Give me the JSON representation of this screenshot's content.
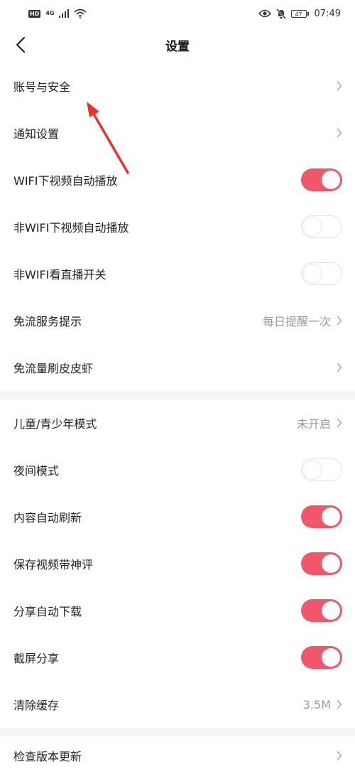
{
  "status_bar": {
    "hd": "HD",
    "network": "4G",
    "battery": "47",
    "time": "07:49"
  },
  "nav": {
    "title": "设置"
  },
  "section1": [
    {
      "label": "账号与安全",
      "type": "link"
    },
    {
      "label": "通知设置",
      "type": "link"
    },
    {
      "label": "WIFI下视频自动播放",
      "type": "toggle",
      "on": true
    },
    {
      "label": "非WIFI下视频自动播放",
      "type": "toggle",
      "on": false
    },
    {
      "label": "非WIFI看直播开关",
      "type": "toggle",
      "on": false
    },
    {
      "label": "免流服务提示",
      "type": "link",
      "value": "每日提醒一次"
    },
    {
      "label": "免流量刷皮皮虾",
      "type": "link"
    }
  ],
  "section2": [
    {
      "label": "儿童/青少年模式",
      "type": "link",
      "value": "未开启"
    },
    {
      "label": "夜间模式",
      "type": "toggle",
      "on": false
    },
    {
      "label": "内容自动刷新",
      "type": "toggle",
      "on": true
    },
    {
      "label": "保存视频带神评",
      "type": "toggle",
      "on": true
    },
    {
      "label": "分享自动下载",
      "type": "toggle",
      "on": true
    },
    {
      "label": "截屏分享",
      "type": "toggle",
      "on": true
    },
    {
      "label": "清除缓存",
      "type": "link",
      "value": "3.5M"
    }
  ],
  "section3": [
    {
      "label": "检查版本更新",
      "type": "link"
    }
  ],
  "colors": {
    "toggle_on": "#f0576a",
    "annotation_arrow": "#e8322f"
  }
}
